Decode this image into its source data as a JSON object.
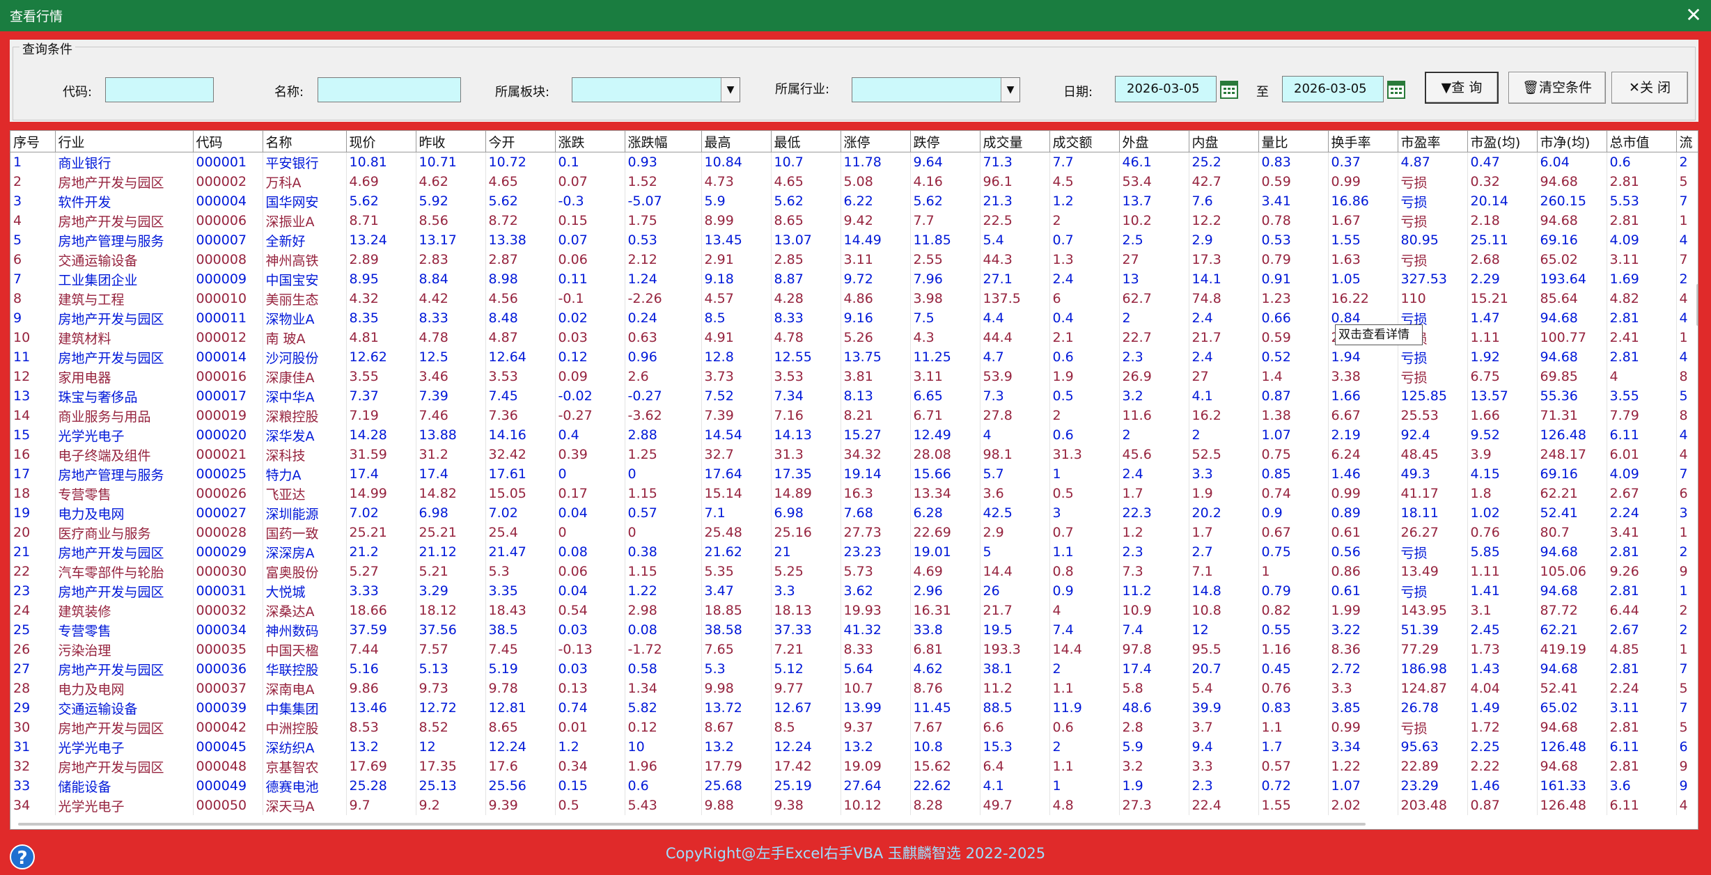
{
  "window": {
    "title": "查看行情",
    "close_label": "✕"
  },
  "conditions": {
    "legend": "查询条件",
    "code_label": "代码:",
    "code_value": "",
    "name_label": "名称:",
    "name_value": "",
    "sector_label": "所属板块:",
    "sector_value": "",
    "industry_label": "所属行业:",
    "industry_value": "",
    "date_label": "日期:",
    "date_from": "2026-03-05",
    "to_label": "至",
    "date_to": "2026-03-05",
    "query_button": "查 询",
    "clear_button": "清空条件",
    "close_button": "关 闭"
  },
  "columns": [
    "序号",
    "行业",
    "代码",
    "名称",
    "现价",
    "昨收",
    "今开",
    "涨跌",
    "涨跌幅",
    "最高",
    "最低",
    "涨停",
    "跌停",
    "成交量",
    "成交额",
    "外盘",
    "内盘",
    "量比",
    "换手率",
    "市盈率",
    "市盈(均)",
    "市净(均)",
    "总市值",
    "流"
  ],
  "rows": [
    {
      "c": "b",
      "v": [
        "1",
        "商业银行",
        "000001",
        "平安银行",
        "10.81",
        "10.71",
        "10.72",
        "0.1",
        "0.93",
        "10.84",
        "10.7",
        "11.78",
        "9.64",
        "71.3",
        "7.7",
        "46.1",
        "25.2",
        "0.83",
        "0.37",
        "4.87",
        "0.47",
        "6.04",
        "0.6",
        "2"
      ]
    },
    {
      "c": "r",
      "v": [
        "2",
        "房地产开发与园区",
        "000002",
        "万科A",
        "4.69",
        "4.62",
        "4.65",
        "0.07",
        "1.52",
        "4.73",
        "4.65",
        "5.08",
        "4.16",
        "96.1",
        "4.5",
        "53.4",
        "42.7",
        "0.59",
        "0.99",
        "亏损",
        "0.32",
        "94.68",
        "2.81",
        "5"
      ]
    },
    {
      "c": "b",
      "v": [
        "3",
        "软件开发",
        "000004",
        "国华网安",
        "5.62",
        "5.92",
        "5.62",
        "-0.3",
        "-5.07",
        "5.9",
        "5.62",
        "6.22",
        "5.62",
        "21.3",
        "1.2",
        "13.7",
        "7.6",
        "3.41",
        "16.86",
        "亏损",
        "20.14",
        "260.15",
        "5.53",
        "7"
      ]
    },
    {
      "c": "r",
      "v": [
        "4",
        "房地产开发与园区",
        "000006",
        "深振业A",
        "8.71",
        "8.56",
        "8.72",
        "0.15",
        "1.75",
        "8.99",
        "8.65",
        "9.42",
        "7.7",
        "22.5",
        "2",
        "10.2",
        "12.2",
        "0.78",
        "1.67",
        "亏损",
        "2.18",
        "94.68",
        "2.81",
        "1"
      ]
    },
    {
      "c": "b",
      "v": [
        "5",
        "房地产管理与服务",
        "000007",
        "全新好",
        "13.24",
        "13.17",
        "13.38",
        "0.07",
        "0.53",
        "13.45",
        "13.07",
        "14.49",
        "11.85",
        "5.4",
        "0.7",
        "2.5",
        "2.9",
        "0.53",
        "1.55",
        "80.95",
        "25.11",
        "69.16",
        "4.09",
        "4"
      ]
    },
    {
      "c": "r",
      "v": [
        "6",
        "交通运输设备",
        "000008",
        "神州高铁",
        "2.89",
        "2.83",
        "2.87",
        "0.06",
        "2.12",
        "2.91",
        "2.85",
        "3.11",
        "2.55",
        "44.3",
        "1.3",
        "27",
        "17.3",
        "0.79",
        "1.63",
        "亏损",
        "2.68",
        "65.02",
        "3.11",
        "7"
      ]
    },
    {
      "c": "b",
      "v": [
        "7",
        "工业集团企业",
        "000009",
        "中国宝安",
        "8.95",
        "8.84",
        "8.98",
        "0.11",
        "1.24",
        "9.18",
        "8.87",
        "9.72",
        "7.96",
        "27.1",
        "2.4",
        "13",
        "14.1",
        "0.91",
        "1.05",
        "327.53",
        "2.29",
        "193.64",
        "1.69",
        "2"
      ]
    },
    {
      "c": "r",
      "v": [
        "8",
        "建筑与工程",
        "000010",
        "美丽生态",
        "4.32",
        "4.42",
        "4.56",
        "-0.1",
        "-2.26",
        "4.57",
        "4.28",
        "4.86",
        "3.98",
        "137.5",
        "6",
        "62.7",
        "74.8",
        "1.23",
        "16.22",
        "110",
        "15.21",
        "85.64",
        "4.82",
        "4"
      ]
    },
    {
      "c": "b",
      "v": [
        "9",
        "房地产开发与园区",
        "000011",
        "深物业A",
        "8.35",
        "8.33",
        "8.48",
        "0.02",
        "0.24",
        "8.5",
        "8.33",
        "9.16",
        "7.5",
        "4.4",
        "0.4",
        "2",
        "2.4",
        "0.66",
        "0.84",
        "亏损",
        "1.47",
        "94.68",
        "2.81",
        "4"
      ]
    },
    {
      "c": "r",
      "v": [
        "10",
        "建筑材料",
        "000012",
        "南 玻A",
        "4.81",
        "4.78",
        "4.87",
        "0.03",
        "0.63",
        "4.91",
        "4.78",
        "5.26",
        "4.3",
        "44.4",
        "2.1",
        "22.7",
        "21.7",
        "0.59",
        "2.1",
        "亏损",
        "1.11",
        "100.77",
        "2.41",
        "1"
      ]
    },
    {
      "c": "b",
      "v": [
        "11",
        "房地产开发与园区",
        "000014",
        "沙河股份",
        "12.62",
        "12.5",
        "12.64",
        "0.12",
        "0.96",
        "12.8",
        "12.55",
        "13.75",
        "11.25",
        "4.7",
        "0.6",
        "2.3",
        "2.4",
        "0.52",
        "1.94",
        "亏损",
        "1.92",
        "94.68",
        "2.81",
        "4"
      ]
    },
    {
      "c": "r",
      "v": [
        "12",
        "家用电器",
        "000016",
        "深康佳A",
        "3.55",
        "3.46",
        "3.53",
        "0.09",
        "2.6",
        "3.73",
        "3.53",
        "3.81",
        "3.11",
        "53.9",
        "1.9",
        "26.9",
        "27",
        "1.4",
        "3.38",
        "亏损",
        "6.75",
        "69.85",
        "4",
        "8"
      ]
    },
    {
      "c": "b",
      "v": [
        "13",
        "珠宝与奢侈品",
        "000017",
        "深中华A",
        "7.37",
        "7.39",
        "7.45",
        "-0.02",
        "-0.27",
        "7.52",
        "7.34",
        "8.13",
        "6.65",
        "7.3",
        "0.5",
        "3.2",
        "4.1",
        "0.87",
        "1.66",
        "125.85",
        "13.57",
        "55.36",
        "3.55",
        "5"
      ]
    },
    {
      "c": "r",
      "v": [
        "14",
        "商业服务与用品",
        "000019",
        "深粮控股",
        "7.19",
        "7.46",
        "7.36",
        "-0.27",
        "-3.62",
        "7.39",
        "7.16",
        "8.21",
        "6.71",
        "27.8",
        "2",
        "11.6",
        "16.2",
        "1.38",
        "6.67",
        "25.53",
        "1.66",
        "71.31",
        "7.79",
        "8"
      ]
    },
    {
      "c": "b",
      "v": [
        "15",
        "光学光电子",
        "000020",
        "深华发A",
        "14.28",
        "13.88",
        "14.16",
        "0.4",
        "2.88",
        "14.54",
        "14.13",
        "15.27",
        "12.49",
        "4",
        "0.6",
        "2",
        "2",
        "1.07",
        "2.19",
        "92.4",
        "9.52",
        "126.48",
        "6.11",
        "4"
      ]
    },
    {
      "c": "r",
      "v": [
        "16",
        "电子终端及组件",
        "000021",
        "深科技",
        "31.59",
        "31.2",
        "32.42",
        "0.39",
        "1.25",
        "32.7",
        "31.3",
        "34.32",
        "28.08",
        "98.1",
        "31.3",
        "45.6",
        "52.5",
        "0.75",
        "6.24",
        "48.45",
        "3.9",
        "248.17",
        "6.01",
        "4"
      ]
    },
    {
      "c": "b",
      "v": [
        "17",
        "房地产管理与服务",
        "000025",
        "特力A",
        "17.4",
        "17.4",
        "17.61",
        "0",
        "0",
        "17.64",
        "17.35",
        "19.14",
        "15.66",
        "5.7",
        "1",
        "2.4",
        "3.3",
        "0.85",
        "1.46",
        "49.3",
        "4.15",
        "69.16",
        "4.09",
        "7"
      ]
    },
    {
      "c": "r",
      "v": [
        "18",
        "专营零售",
        "000026",
        "飞亚达",
        "14.99",
        "14.82",
        "15.05",
        "0.17",
        "1.15",
        "15.14",
        "14.89",
        "16.3",
        "13.34",
        "3.6",
        "0.5",
        "1.7",
        "1.9",
        "0.74",
        "0.99",
        "41.17",
        "1.8",
        "62.21",
        "2.67",
        "6"
      ]
    },
    {
      "c": "b",
      "v": [
        "19",
        "电力及电网",
        "000027",
        "深圳能源",
        "7.02",
        "6.98",
        "7.02",
        "0.04",
        "0.57",
        "7.1",
        "6.98",
        "7.68",
        "6.28",
        "42.5",
        "3",
        "22.3",
        "20.2",
        "0.9",
        "0.89",
        "18.11",
        "1.02",
        "52.41",
        "2.24",
        "3"
      ]
    },
    {
      "c": "r",
      "v": [
        "20",
        "医疗商业与服务",
        "000028",
        "国药一致",
        "25.21",
        "25.21",
        "25.4",
        "0",
        "0",
        "25.48",
        "25.16",
        "27.73",
        "22.69",
        "2.9",
        "0.7",
        "1.2",
        "1.7",
        "0.67",
        "0.61",
        "26.27",
        "0.76",
        "80.7",
        "3.41",
        "1"
      ]
    },
    {
      "c": "b",
      "v": [
        "21",
        "房地产开发与园区",
        "000029",
        "深深房A",
        "21.2",
        "21.12",
        "21.47",
        "0.08",
        "0.38",
        "21.62",
        "21",
        "23.23",
        "19.01",
        "5",
        "1.1",
        "2.3",
        "2.7",
        "0.75",
        "0.56",
        "亏损",
        "5.85",
        "94.68",
        "2.81",
        "2"
      ]
    },
    {
      "c": "r",
      "v": [
        "22",
        "汽车零部件与轮胎",
        "000030",
        "富奥股份",
        "5.27",
        "5.21",
        "5.3",
        "0.06",
        "1.15",
        "5.35",
        "5.25",
        "5.73",
        "4.69",
        "14.4",
        "0.8",
        "7.3",
        "7.1",
        "1",
        "0.86",
        "13.49",
        "1.11",
        "105.06",
        "9.26",
        "9"
      ]
    },
    {
      "c": "b",
      "v": [
        "23",
        "房地产开发与园区",
        "000031",
        "大悦城",
        "3.33",
        "3.29",
        "3.35",
        "0.04",
        "1.22",
        "3.47",
        "3.3",
        "3.62",
        "2.96",
        "26",
        "0.9",
        "11.2",
        "14.8",
        "0.79",
        "0.61",
        "亏损",
        "1.41",
        "94.68",
        "2.81",
        "1"
      ]
    },
    {
      "c": "r",
      "v": [
        "24",
        "建筑装修",
        "000032",
        "深桑达A",
        "18.66",
        "18.12",
        "18.43",
        "0.54",
        "2.98",
        "18.85",
        "18.13",
        "19.93",
        "16.31",
        "21.7",
        "4",
        "10.9",
        "10.8",
        "0.82",
        "1.99",
        "143.95",
        "3.1",
        "87.72",
        "6.44",
        "2"
      ]
    },
    {
      "c": "b",
      "v": [
        "25",
        "专营零售",
        "000034",
        "神州数码",
        "37.59",
        "37.56",
        "38.5",
        "0.03",
        "0.08",
        "38.58",
        "37.33",
        "41.32",
        "33.8",
        "19.5",
        "7.4",
        "7.4",
        "12",
        "0.55",
        "3.22",
        "51.39",
        "2.45",
        "62.21",
        "2.67",
        "2"
      ]
    },
    {
      "c": "r",
      "v": [
        "26",
        "污染治理",
        "000035",
        "中国天楹",
        "7.44",
        "7.57",
        "7.45",
        "-0.13",
        "-1.72",
        "7.65",
        "7.21",
        "8.33",
        "6.81",
        "193.3",
        "14.4",
        "97.8",
        "95.5",
        "1.16",
        "8.36",
        "77.29",
        "1.73",
        "419.19",
        "4.85",
        "1"
      ]
    },
    {
      "c": "b",
      "v": [
        "27",
        "房地产开发与园区",
        "000036",
        "华联控股",
        "5.16",
        "5.13",
        "5.19",
        "0.03",
        "0.58",
        "5.3",
        "5.12",
        "5.64",
        "4.62",
        "38.1",
        "2",
        "17.4",
        "20.7",
        "0.45",
        "2.72",
        "186.98",
        "1.43",
        "94.68",
        "2.81",
        "7"
      ]
    },
    {
      "c": "r",
      "v": [
        "28",
        "电力及电网",
        "000037",
        "深南电A",
        "9.86",
        "9.73",
        "9.78",
        "0.13",
        "1.34",
        "9.98",
        "9.77",
        "10.7",
        "8.76",
        "11.2",
        "1.1",
        "5.8",
        "5.4",
        "0.76",
        "3.3",
        "124.87",
        "4.04",
        "52.41",
        "2.24",
        "5"
      ]
    },
    {
      "c": "b",
      "v": [
        "29",
        "交通运输设备",
        "000039",
        "中集集团",
        "13.46",
        "12.72",
        "12.81",
        "0.74",
        "5.82",
        "13.72",
        "12.67",
        "13.99",
        "11.45",
        "88.5",
        "11.9",
        "48.6",
        "39.9",
        "0.83",
        "3.85",
        "26.78",
        "1.49",
        "65.02",
        "3.11",
        "7"
      ]
    },
    {
      "c": "r",
      "v": [
        "30",
        "房地产开发与园区",
        "000042",
        "中洲控股",
        "8.53",
        "8.52",
        "8.65",
        "0.01",
        "0.12",
        "8.67",
        "8.5",
        "9.37",
        "7.67",
        "6.6",
        "0.6",
        "2.8",
        "3.7",
        "1.1",
        "0.99",
        "亏损",
        "1.72",
        "94.68",
        "2.81",
        "5"
      ]
    },
    {
      "c": "b",
      "v": [
        "31",
        "光学光电子",
        "000045",
        "深纺织A",
        "13.2",
        "12",
        "12.24",
        "1.2",
        "10",
        "13.2",
        "12.24",
        "13.2",
        "10.8",
        "15.3",
        "2",
        "5.9",
        "9.4",
        "1.7",
        "3.34",
        "95.63",
        "2.25",
        "126.48",
        "6.11",
        "6"
      ]
    },
    {
      "c": "r",
      "v": [
        "32",
        "房地产开发与园区",
        "000048",
        "京基智农",
        "17.69",
        "17.35",
        "17.6",
        "0.34",
        "1.96",
        "17.79",
        "17.42",
        "19.09",
        "15.62",
        "6.4",
        "1.1",
        "3.2",
        "3.3",
        "0.57",
        "1.22",
        "22.89",
        "2.22",
        "94.68",
        "2.81",
        "9"
      ]
    },
    {
      "c": "b",
      "v": [
        "33",
        "储能设备",
        "000049",
        "德赛电池",
        "25.28",
        "25.13",
        "25.56",
        "0.15",
        "0.6",
        "25.68",
        "25.19",
        "27.64",
        "22.62",
        "4.1",
        "1",
        "1.9",
        "2.3",
        "0.72",
        "1.07",
        "23.29",
        "1.46",
        "161.33",
        "3.6",
        "9"
      ]
    },
    {
      "c": "r",
      "v": [
        "34",
        "光学光电子",
        "000050",
        "深天马A",
        "9.7",
        "9.2",
        "9.39",
        "0.5",
        "5.43",
        "9.88",
        "9.38",
        "10.12",
        "8.28",
        "49.7",
        "4.8",
        "27.3",
        "22.4",
        "1.55",
        "2.02",
        "203.48",
        "0.87",
        "126.48",
        "6.11",
        "4"
      ]
    }
  ],
  "tooltip": "双击查看详情",
  "footer": "CopyRight@左手Excel右手VBA 玉麒麟智选  2022-2025",
  "help_label": "?",
  "colors": {
    "titlebar": "#1a7d40",
    "frame": "#e02a2a",
    "input_bg": "#ccf9fb",
    "blue_row": "#0018d8",
    "red_row": "#96233e",
    "footer_text": "#9fdfff"
  }
}
